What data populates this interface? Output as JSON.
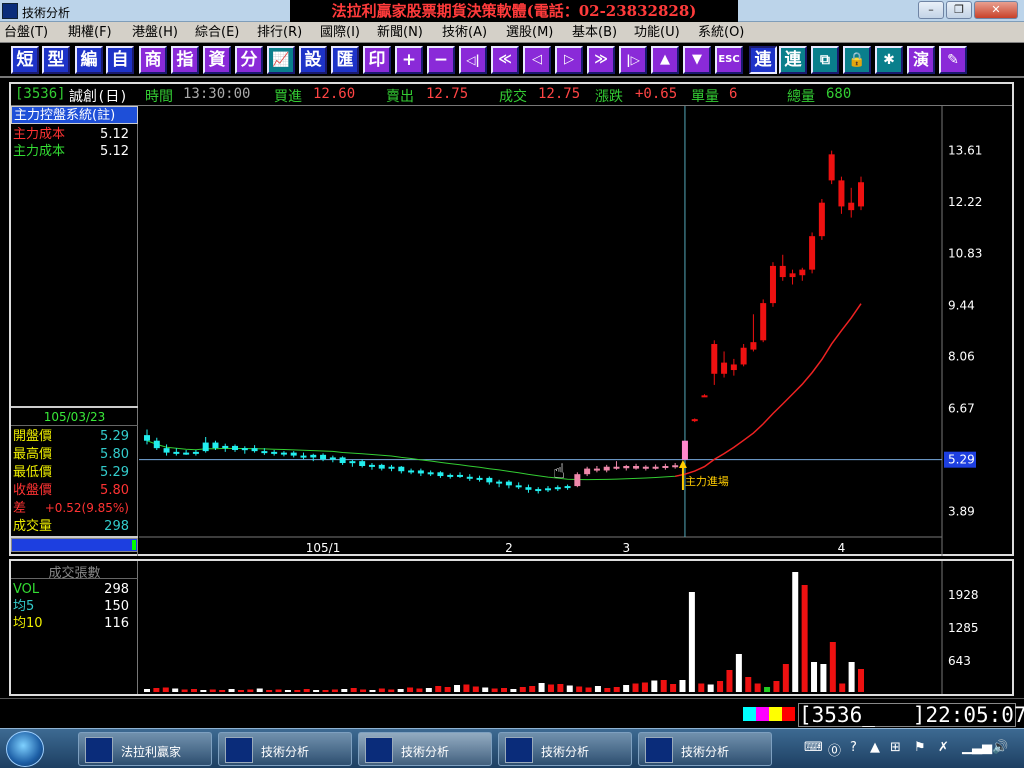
{
  "window": {
    "title": "技術分析",
    "banner": "法拉利贏家股票期貨決策軟體(電話：02-23832828)",
    "controls": [
      "–",
      "❐",
      "✕"
    ]
  },
  "menu": [
    "台盤(T)",
    "期權(F)",
    "港盤(H)",
    "綜合(E)",
    "排行(R)",
    "國際(I)",
    "新聞(N)",
    "技術(A)",
    "選股(M)",
    "基本(B)",
    "功能(U)",
    "系統(O)"
  ],
  "toolbar": {
    "text_buttons": [
      "短",
      "型",
      "編",
      "自",
      "商",
      "指",
      "資",
      "分"
    ],
    "text_buttons2": [
      "設",
      "匯",
      "印"
    ],
    "nav_buttons": [
      "+",
      "−",
      "◁|",
      "≪",
      "◁",
      "▷",
      "≫",
      "|▷",
      "▲",
      "▼"
    ],
    "right_buttons": [
      "連",
      "連"
    ]
  },
  "quote": {
    "code": "[3536]",
    "name": "誠創(日)",
    "time_label": "時間",
    "time": "13:30:00",
    "bid_label": "買進",
    "bid": "12.60",
    "ask_label": "賣出",
    "ask": "12.75",
    "last_label": "成交",
    "last": "12.75",
    "chg_label": "漲跌",
    "chg": "+0.65",
    "unit_label": "單量",
    "unit": "6",
    "total_label": "總量",
    "total": "680"
  },
  "left_panel": {
    "system": "主力控盤系統(註)",
    "cost1_label": "主力成本",
    "cost1": "5.12",
    "cost2_label": "主力成本",
    "cost2": "5.12"
  },
  "ohlc": {
    "date": "105/03/23",
    "open_label": "開盤價",
    "open": "5.29",
    "high_label": "最高價",
    "high": "5.80",
    "low_label": "最低價",
    "low": "5.29",
    "close_label": "收盤價",
    "close": "5.80",
    "diff_label": "差",
    "diff": "+0.52(9.85%)",
    "vol_label": "成交量",
    "vol": "298"
  },
  "volume_panel": {
    "title": "成交張數",
    "vol_label": "VOL",
    "vol": "298",
    "ma5_label": "均5",
    "ma5": "150",
    "ma10_label": "均10",
    "ma10": "116"
  },
  "chart_data": [
    {
      "type": "candlestick",
      "title": "誠創(日)",
      "y_ticks": [
        13.61,
        12.22,
        10.83,
        9.44,
        8.06,
        6.67,
        5.29,
        3.89
      ],
      "x_ticks": [
        "105/1",
        "2",
        "3",
        "4"
      ],
      "current_price_marker": "5.29",
      "annotation": "主力進場",
      "candles": [
        {
          "o": 5.95,
          "h": 6.1,
          "l": 5.7,
          "c": 5.8
        },
        {
          "o": 5.8,
          "h": 5.88,
          "l": 5.55,
          "c": 5.6
        },
        {
          "o": 5.6,
          "h": 5.7,
          "l": 5.4,
          "c": 5.48
        },
        {
          "o": 5.46,
          "h": 5.6,
          "l": 5.4,
          "c": 5.5
        },
        {
          "o": 5.48,
          "h": 5.55,
          "l": 5.42,
          "c": 5.46
        },
        {
          "o": 5.46,
          "h": 5.55,
          "l": 5.4,
          "c": 5.5
        },
        {
          "o": 5.52,
          "h": 5.9,
          "l": 5.48,
          "c": 5.75
        },
        {
          "o": 5.75,
          "h": 5.8,
          "l": 5.55,
          "c": 5.6
        },
        {
          "o": 5.6,
          "h": 5.72,
          "l": 5.5,
          "c": 5.66
        },
        {
          "o": 5.66,
          "h": 5.7,
          "l": 5.5,
          "c": 5.55
        },
        {
          "o": 5.55,
          "h": 5.65,
          "l": 5.45,
          "c": 5.6
        },
        {
          "o": 5.6,
          "h": 5.68,
          "l": 5.48,
          "c": 5.52
        },
        {
          "o": 5.52,
          "h": 5.6,
          "l": 5.42,
          "c": 5.5
        },
        {
          "o": 5.5,
          "h": 5.55,
          "l": 5.4,
          "c": 5.45
        },
        {
          "o": 5.45,
          "h": 5.52,
          "l": 5.38,
          "c": 5.48
        },
        {
          "o": 5.48,
          "h": 5.52,
          "l": 5.35,
          "c": 5.4
        },
        {
          "o": 5.4,
          "h": 5.48,
          "l": 5.3,
          "c": 5.35
        },
        {
          "o": 5.35,
          "h": 5.45,
          "l": 5.25,
          "c": 5.42
        },
        {
          "o": 5.42,
          "h": 5.46,
          "l": 5.25,
          "c": 5.3
        },
        {
          "o": 5.3,
          "h": 5.4,
          "l": 5.22,
          "c": 5.35
        },
        {
          "o": 5.35,
          "h": 5.38,
          "l": 5.15,
          "c": 5.2
        },
        {
          "o": 5.2,
          "h": 5.28,
          "l": 5.1,
          "c": 5.25
        },
        {
          "o": 5.25,
          "h": 5.3,
          "l": 5.08,
          "c": 5.12
        },
        {
          "o": 5.12,
          "h": 5.2,
          "l": 5.02,
          "c": 5.15
        },
        {
          "o": 5.15,
          "h": 5.18,
          "l": 5.0,
          "c": 5.05
        },
        {
          "o": 5.05,
          "h": 5.15,
          "l": 4.98,
          "c": 5.1
        },
        {
          "o": 5.1,
          "h": 5.12,
          "l": 4.92,
          "c": 4.98
        },
        {
          "o": 4.98,
          "h": 5.05,
          "l": 4.9,
          "c": 5.0
        },
        {
          "o": 5.0,
          "h": 5.05,
          "l": 4.85,
          "c": 4.92
        },
        {
          "o": 4.92,
          "h": 5.0,
          "l": 4.85,
          "c": 4.95
        },
        {
          "o": 4.95,
          "h": 4.98,
          "l": 4.8,
          "c": 4.85
        },
        {
          "o": 4.85,
          "h": 4.92,
          "l": 4.78,
          "c": 4.88
        },
        {
          "o": 4.88,
          "h": 4.95,
          "l": 4.8,
          "c": 4.83
        },
        {
          "o": 4.83,
          "h": 4.9,
          "l": 4.72,
          "c": 4.78
        },
        {
          "o": 4.78,
          "h": 4.86,
          "l": 4.7,
          "c": 4.8
        },
        {
          "o": 4.8,
          "h": 4.84,
          "l": 4.62,
          "c": 4.68
        },
        {
          "o": 4.68,
          "h": 4.75,
          "l": 4.55,
          "c": 4.7
        },
        {
          "o": 4.7,
          "h": 4.74,
          "l": 4.52,
          "c": 4.6
        },
        {
          "o": 4.6,
          "h": 4.68,
          "l": 4.5,
          "c": 4.55
        },
        {
          "o": 4.55,
          "h": 4.62,
          "l": 4.4,
          "c": 4.48
        },
        {
          "o": 4.48,
          "h": 4.55,
          "l": 4.38,
          "c": 4.5
        },
        {
          "o": 4.5,
          "h": 4.58,
          "l": 4.42,
          "c": 4.52
        },
        {
          "o": 4.52,
          "h": 4.6,
          "l": 4.45,
          "c": 4.55
        },
        {
          "o": 4.55,
          "h": 4.62,
          "l": 4.48,
          "c": 4.58
        },
        {
          "o": 4.58,
          "h": 4.95,
          "l": 4.55,
          "c": 4.9
        },
        {
          "o": 4.9,
          "h": 5.1,
          "l": 4.85,
          "c": 5.05
        },
        {
          "o": 5.05,
          "h": 5.12,
          "l": 4.95,
          "c": 5.0
        },
        {
          "o": 5.0,
          "h": 5.15,
          "l": 4.95,
          "c": 5.1
        },
        {
          "o": 5.1,
          "h": 5.25,
          "l": 5.02,
          "c": 5.06
        },
        {
          "o": 5.06,
          "h": 5.15,
          "l": 5.0,
          "c": 5.12
        },
        {
          "o": 5.12,
          "h": 5.18,
          "l": 5.02,
          "c": 5.05
        },
        {
          "o": 5.05,
          "h": 5.14,
          "l": 5.0,
          "c": 5.1
        },
        {
          "o": 5.1,
          "h": 5.16,
          "l": 5.02,
          "c": 5.08
        },
        {
          "o": 5.08,
          "h": 5.18,
          "l": 5.02,
          "c": 5.12
        },
        {
          "o": 5.12,
          "h": 5.2,
          "l": 5.05,
          "c": 5.14
        },
        {
          "o": 5.29,
          "h": 5.8,
          "l": 5.29,
          "c": 5.8
        },
        {
          "o": 6.35,
          "h": 6.4,
          "l": 6.3,
          "c": 6.38
        },
        {
          "o": 7.0,
          "h": 7.05,
          "l": 6.98,
          "c": 7.02
        },
        {
          "o": 7.6,
          "h": 8.5,
          "l": 7.3,
          "c": 8.4
        },
        {
          "o": 7.9,
          "h": 8.2,
          "l": 7.5,
          "c": 7.6
        },
        {
          "o": 7.7,
          "h": 8.0,
          "l": 7.55,
          "c": 7.85
        },
        {
          "o": 7.85,
          "h": 8.4,
          "l": 7.8,
          "c": 8.3
        },
        {
          "o": 8.25,
          "h": 9.2,
          "l": 8.2,
          "c": 8.45
        },
        {
          "o": 8.5,
          "h": 9.6,
          "l": 8.45,
          "c": 9.5
        },
        {
          "o": 9.5,
          "h": 10.6,
          "l": 9.4,
          "c": 10.5
        },
        {
          "o": 10.5,
          "h": 10.8,
          "l": 10.1,
          "c": 10.2
        },
        {
          "o": 10.2,
          "h": 10.4,
          "l": 10.0,
          "c": 10.3
        },
        {
          "o": 10.25,
          "h": 10.45,
          "l": 10.1,
          "c": 10.4
        },
        {
          "o": 10.4,
          "h": 11.4,
          "l": 10.3,
          "c": 11.3
        },
        {
          "o": 11.3,
          "h": 12.3,
          "l": 11.2,
          "c": 12.2
        },
        {
          "o": 12.8,
          "h": 13.6,
          "l": 12.7,
          "c": 13.5
        },
        {
          "o": 12.8,
          "h": 12.9,
          "l": 11.9,
          "c": 12.1
        },
        {
          "o": 12.2,
          "h": 12.6,
          "l": 11.8,
          "c": 12.0
        },
        {
          "o": 12.1,
          "h": 12.9,
          "l": 12.0,
          "c": 12.75
        }
      ]
    },
    {
      "type": "bar",
      "title": "成交張數",
      "y_ticks": [
        1928,
        1285,
        643
      ],
      "values": [
        60,
        80,
        90,
        70,
        50,
        60,
        40,
        50,
        30,
        60,
        40,
        50,
        70,
        40,
        50,
        30,
        40,
        60,
        30,
        40,
        50,
        60,
        80,
        50,
        40,
        70,
        50,
        60,
        90,
        70,
        80,
        120,
        100,
        140,
        150,
        110,
        90,
        70,
        80,
        60,
        100,
        120,
        180,
        150,
        160,
        130,
        110,
        90,
        120,
        80,
        100,
        140,
        170,
        190,
        230,
        240,
        160,
        240,
        2000,
        170,
        150,
        220,
        440,
        760,
        300,
        170,
        100,
        220,
        560,
        2400,
        2140,
        600,
        560,
        1000,
        170,
        600,
        460
      ]
    }
  ],
  "status": {
    "code_box": "[3536_   ]",
    "clock": "22:05:07"
  },
  "taskbar": {
    "items": [
      "法拉利贏家",
      "技術分析",
      "技術分析",
      "技術分析",
      "技術分析"
    ]
  }
}
